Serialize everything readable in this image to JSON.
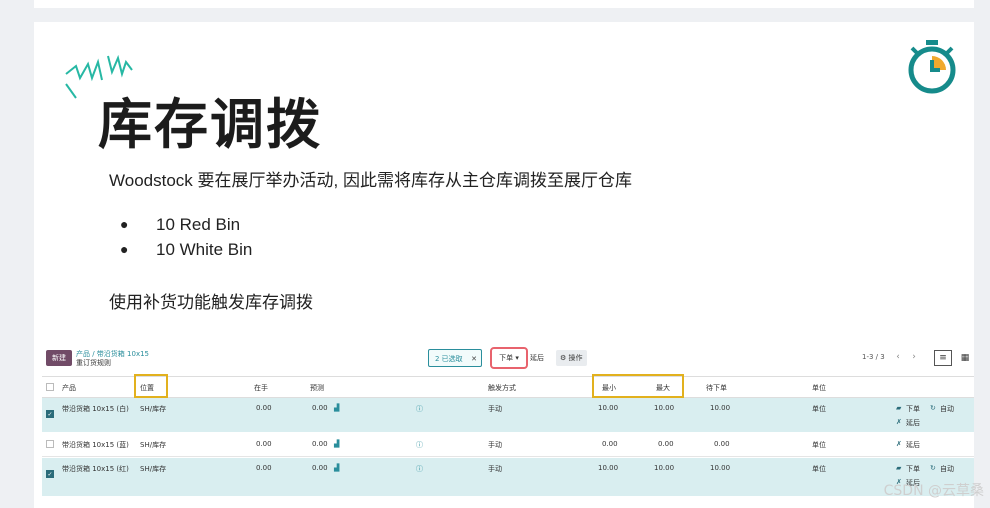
{
  "slide": {
    "title": "库存调拨",
    "intro": "Woodstock 要在展厅举办活动, 因此需将库存从主仓库调拨至展厅仓库",
    "bullets": [
      "10 Red Bin",
      "10 White Bin"
    ],
    "action_text": "使用补货功能触发库存调拨"
  },
  "app": {
    "new_button": "新建",
    "breadcrumb": "产品 / 带沿货箱 10x15",
    "breadcrumb_sub": "重订货规则",
    "filter_tag": "2 已选取",
    "filter_close": "✕",
    "order_button": "下单 ▾",
    "postpone_button": "延后",
    "action_button": "⚙ 操作",
    "pager": "1-3 / 3",
    "columns": {
      "product": "产品",
      "location": "位置",
      "on_hand": "在手",
      "forecast": "预测",
      "trigger": "触发方式",
      "min": "最小",
      "max": "最大",
      "to_order": "待下单",
      "uom": "单位"
    },
    "rows": [
      {
        "product": "带沿货箱 10x15 (白)",
        "location": "SH/库存",
        "on_hand": "0.00",
        "forecast": "0.00",
        "trigger": "手动",
        "min": "10.00",
        "max": "10.00",
        "to_order": "10.00",
        "uom": "单位",
        "selected": true,
        "order": "下单",
        "auto": "自动",
        "snooze": "延后"
      },
      {
        "product": "带沿货箱 10x15 (蓝)",
        "location": "SH/库存",
        "on_hand": "0.00",
        "forecast": "0.00",
        "trigger": "手动",
        "min": "0.00",
        "max": "0.00",
        "to_order": "0.00",
        "uom": "单位",
        "selected": false,
        "snooze": "延后"
      },
      {
        "product": "带沿货箱 10x15 (红)",
        "location": "SH/库存",
        "on_hand": "0.00",
        "forecast": "0.00",
        "trigger": "手动",
        "min": "10.00",
        "max": "10.00",
        "to_order": "10.00",
        "uom": "单位",
        "selected": true,
        "order": "下单",
        "auto": "自动",
        "snooze": "延后"
      }
    ]
  },
  "watermark": "CSDN @云草桑",
  "colors": {
    "accent": "#2a8e9c",
    "brand": "#714b67",
    "highlight": "#e2b11e",
    "red_outline": "#e8636d"
  }
}
